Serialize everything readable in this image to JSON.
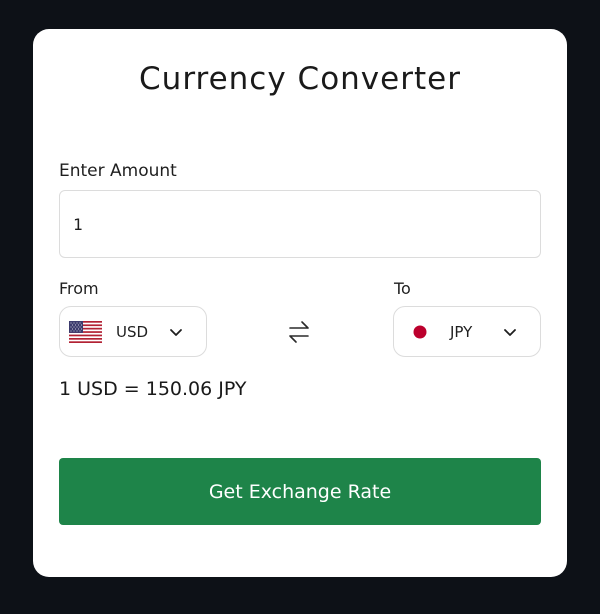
{
  "app": {
    "title": "Currency Converter"
  },
  "amount": {
    "label": "Enter Amount",
    "value": "1"
  },
  "from": {
    "label": "From",
    "currency": "USD",
    "flag_icon": "us-flag-icon"
  },
  "to": {
    "label": "To",
    "currency": "JPY",
    "flag_icon": "jp-flag-icon"
  },
  "rate_text": "1 USD = 150.06 JPY",
  "button": {
    "label": "Get Exchange Rate"
  },
  "colors": {
    "background": "#0d1117",
    "card": "#ffffff",
    "button": "#1e8449",
    "jp_flag_red": "#bc002d"
  }
}
